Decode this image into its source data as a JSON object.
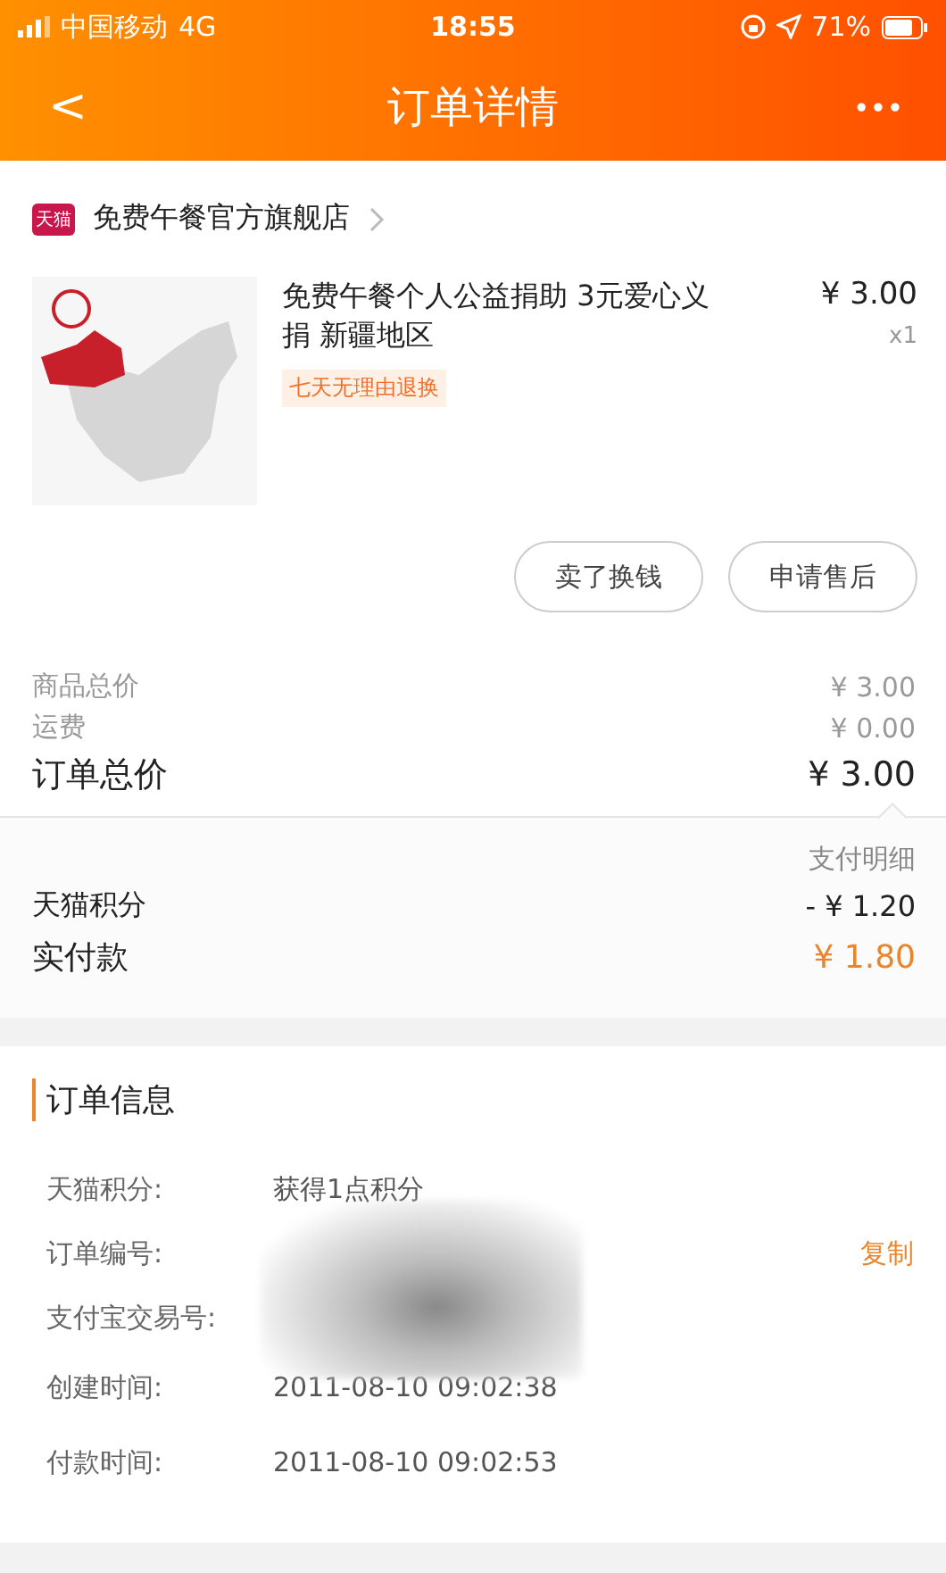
{
  "status_bar": {
    "carrier": "中国移动",
    "network": "4G",
    "time": "18:55",
    "battery": "71%"
  },
  "nav": {
    "back": "<",
    "title": "订单详情",
    "more": "•••"
  },
  "store": {
    "badge": "天猫",
    "name": "免费午餐官方旗舰店"
  },
  "product": {
    "title": "免费午餐个人公益捐助 3元爱心义捐 新疆地区",
    "price": "¥ 3.00",
    "quantity": "x1",
    "tag": "七天无理由退换"
  },
  "actions": [
    "卖了换钱",
    "申请售后"
  ],
  "summary": [
    {
      "label": "商品总价",
      "value": "¥ 3.00",
      "kind": "minor"
    },
    {
      "label": "运费",
      "value": "¥ 0.00",
      "kind": "minor"
    },
    {
      "label": "订单总价",
      "value": "¥ 3.00",
      "kind": "total"
    }
  ],
  "payment": {
    "heading": "支付明细",
    "rows": [
      {
        "label": "天猫积分",
        "value": "- ¥ 1.20",
        "kind": "normal"
      },
      {
        "label": "实付款",
        "value": "¥ 1.80",
        "kind": "paid"
      }
    ]
  },
  "order_info": {
    "title": "订单信息",
    "rows": [
      {
        "label": "天猫积分:",
        "value": "获得1点积分"
      },
      {
        "label": "订单编号:",
        "action": "复制"
      },
      {
        "label": "支付宝交易号:"
      },
      {
        "label": "创建时间:",
        "value": "2011-08-10 09:02:38"
      },
      {
        "label": "付款时间:",
        "value": "2011-08-10 09:02:53"
      }
    ]
  }
}
